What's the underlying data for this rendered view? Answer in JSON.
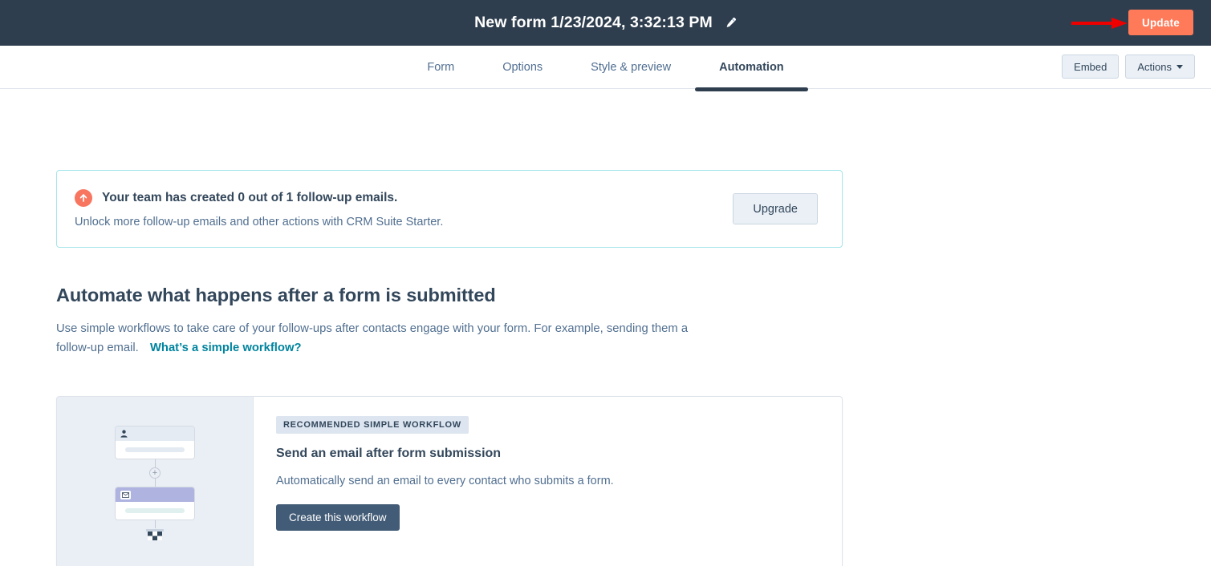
{
  "topbar": {
    "form_title": "New form 1/23/2024, 3:32:13 PM",
    "edit_icon": "pencil-icon",
    "update_label": "Update",
    "update_color": "#ff7a59",
    "background": "#2e3e4e",
    "annotation_arrow_color": "#ee0000"
  },
  "nav": {
    "tabs": [
      {
        "label": "Form",
        "active": false
      },
      {
        "label": "Options",
        "active": false
      },
      {
        "label": "Style & preview",
        "active": false
      },
      {
        "label": "Automation",
        "active": true
      }
    ],
    "embed_label": "Embed",
    "actions_label": "Actions"
  },
  "banner": {
    "icon": "upgrade-arrow-icon",
    "icon_color": "#f8765f",
    "border_color": "#a5e5ea",
    "title": "Your team has created 0 out of 1 follow-up emails.",
    "subtitle": "Unlock more follow-up emails and other actions with CRM Suite Starter.",
    "upgrade_label": "Upgrade"
  },
  "section": {
    "heading": "Automate what happens after a form is submitted",
    "description": "Use simple workflows to take care of your follow-ups after contacts engage with your form. For example, sending them a follow-up email.",
    "link_label": "What’s a simple workflow?",
    "link_color": "#00849e"
  },
  "recommendation": {
    "badge": "RECOMMENDED SIMPLE WORKFLOW",
    "title": "Send an email after form submission",
    "description": "Automatically send an email to every contact who submits a form.",
    "button_label": "Create this workflow",
    "button_color": "#425b76",
    "illustration": {
      "trigger_icon": "contact-person-icon",
      "plus_icon": "add-step-icon",
      "action_icon": "email-envelope-icon",
      "end_icon": "checkered-flag-icon",
      "action_header_color": "#aeb3e0"
    }
  }
}
